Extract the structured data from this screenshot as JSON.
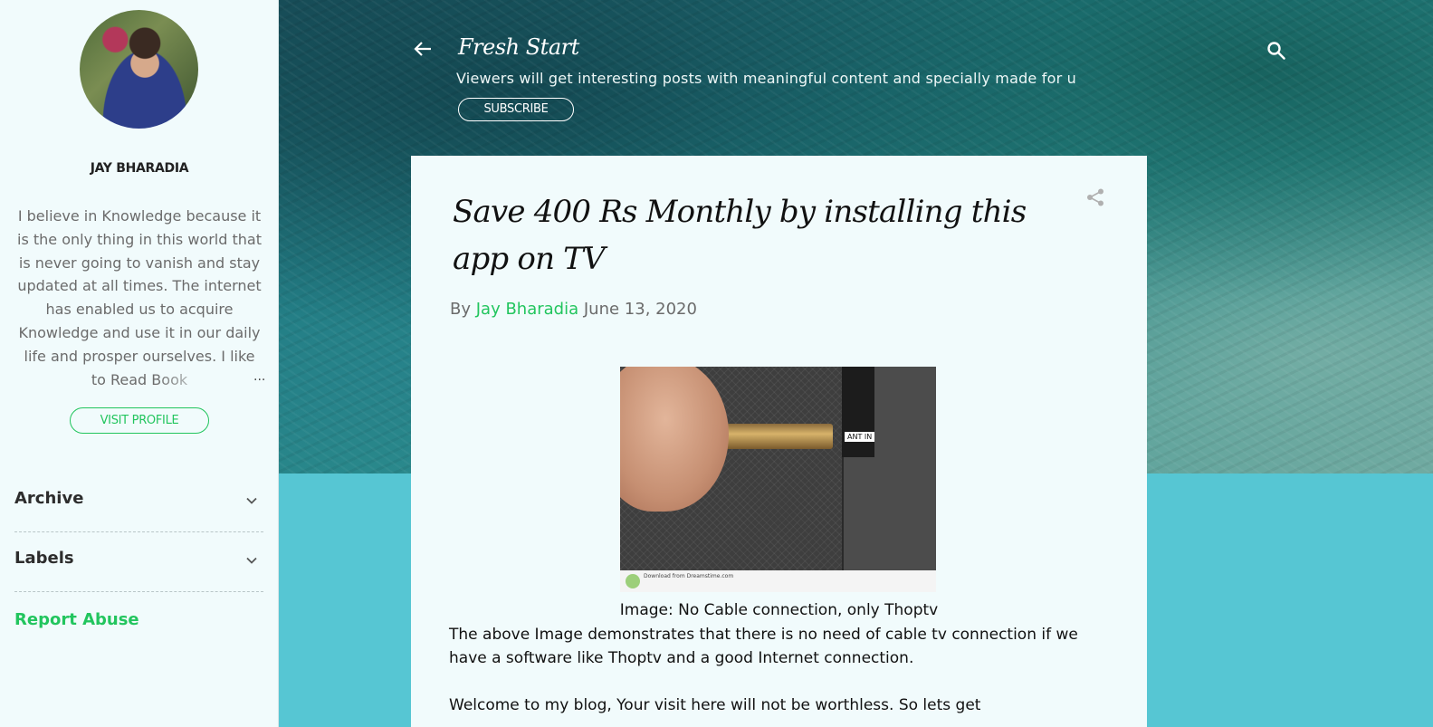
{
  "sidebar": {
    "author_name": "JAY BHARADIA",
    "bio": "I believe in Knowledge because it is the only thing in this world that is never going to vanish and stay updated at all times. The internet has enabled us to acquire Knowledge and use it in our daily life and prosper ourselves. I like to Read Book",
    "bio_ellipsis": "...",
    "visit_profile_label": "VISIT PROFILE",
    "widgets": [
      {
        "title": "Archive",
        "icon": "chevron-down-icon"
      },
      {
        "title": "Labels",
        "icon": "chevron-down-icon"
      }
    ],
    "report_abuse_label": "Report Abuse"
  },
  "header": {
    "blog_title": "Fresh Start",
    "description": "Viewers will get interesting posts with meaningful content and specially made for u",
    "subscribe_label": "SUBSCRIBE",
    "back_icon": "back-arrow-icon",
    "search_icon": "search-icon"
  },
  "post": {
    "title": "Save 400 Rs Monthly by installing this app on TV",
    "by_label": "By",
    "author": "Jay Bharadia",
    "date": "June 13, 2020",
    "share_icon": "share-icon",
    "image": {
      "ant_label": "ANT IN",
      "footer_text": "Download from Dreamstime.com"
    },
    "caption": "Image: No Cable connection, only Thoptv",
    "paragraphs": [
      "The above Image demonstrates that there is no need of cable tv connection if we have a software like Thoptv and a good Internet connection.",
      "Welcome to my blog, Your visit here will not be worthless. So lets get"
    ]
  },
  "colors": {
    "accent_green": "#22c55e",
    "page_background": "#56c6d3",
    "card_background": "#f1fbfc"
  }
}
